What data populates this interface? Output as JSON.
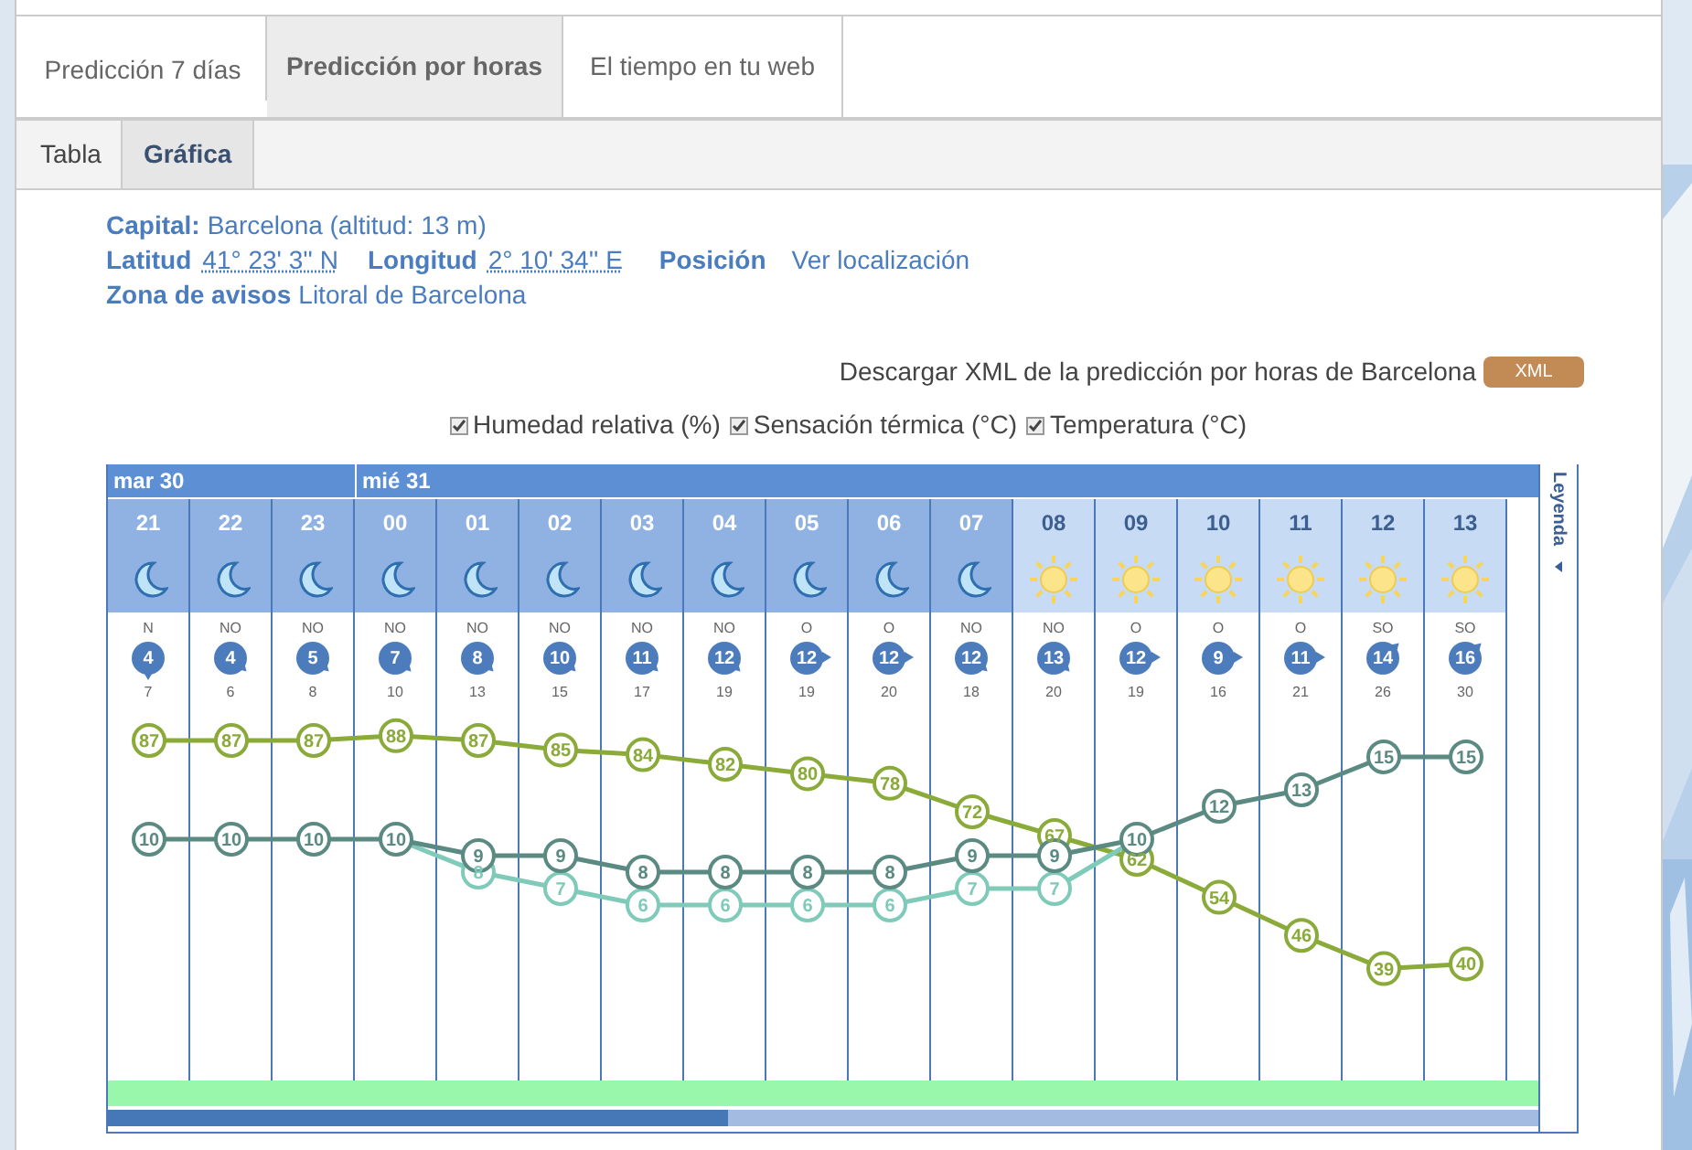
{
  "tabs": [
    {
      "label": "Predicción 7 días",
      "selected": false
    },
    {
      "label": "Predicción por horas",
      "selected": true
    },
    {
      "label": "El tiempo en tu web",
      "selected": false
    }
  ],
  "subtabs": [
    {
      "label": "Tabla",
      "selected": false
    },
    {
      "label": "Gráfica",
      "selected": true
    }
  ],
  "info": {
    "capital_label": "Capital:",
    "capital": "Barcelona (altitud: 13 m)",
    "lat_label": "Latitud",
    "lat": "41° 23' 3'' N",
    "lon_label": "Longitud",
    "lon": "2° 10' 34'' E",
    "pos_label": "Posición",
    "pos_link": "Ver localización",
    "zone_label": "Zona de avisos",
    "zone": "Litoral de Barcelona"
  },
  "download": {
    "text": "Descargar XML de la predicción por horas de Barcelona",
    "button": "XML"
  },
  "filters": [
    {
      "label": "Humedad relativa (%)",
      "checked": true
    },
    {
      "label": "Sensación térmica (°C)",
      "checked": true
    },
    {
      "label": "Temperatura (°C)",
      "checked": true
    }
  ],
  "days": [
    {
      "label": "mar 30",
      "columns": [
        {
          "hour": "21",
          "kind": "night",
          "wind": {
            "direction": "N",
            "speed": "4",
            "kind": "south"
          },
          "gust": "7",
          "humidity": "87",
          "temperature": "10"
        },
        {
          "hour": "22",
          "kind": "night",
          "wind": {
            "direction": "NO",
            "speed": "4",
            "kind": "southeast"
          },
          "gust": "6",
          "humidity": "87",
          "temperature": "10"
        },
        {
          "hour": "23",
          "kind": "night",
          "wind": {
            "direction": "NO",
            "speed": "5",
            "kind": "southeast"
          },
          "gust": "8",
          "humidity": "87",
          "temperature": "10"
        }
      ]
    },
    {
      "label": "mié 31",
      "columns": [
        {
          "hour": "00",
          "kind": "night",
          "wind": {
            "direction": "NO",
            "speed": "7",
            "kind": "southeast"
          },
          "gust": "10",
          "humidity": "88",
          "temperature": "10"
        },
        {
          "hour": "01",
          "kind": "night",
          "wind": {
            "direction": "NO",
            "speed": "8",
            "kind": "southeast"
          },
          "gust": "13",
          "humidity": "87",
          "feels_like": "8",
          "temperature": "9"
        },
        {
          "hour": "02",
          "kind": "night",
          "wind": {
            "direction": "NO",
            "speed": "10",
            "kind": "southeast"
          },
          "gust": "15",
          "humidity": "85",
          "feels_like": "7",
          "temperature": "9"
        },
        {
          "hour": "03",
          "kind": "night",
          "wind": {
            "direction": "NO",
            "speed": "11",
            "kind": "southeast"
          },
          "gust": "17",
          "humidity": "84",
          "feels_like": "6",
          "temperature": "8"
        },
        {
          "hour": "04",
          "kind": "night",
          "wind": {
            "direction": "NO",
            "speed": "12",
            "kind": "southeast"
          },
          "gust": "19",
          "humidity": "82",
          "feels_like": "6",
          "temperature": "8"
        },
        {
          "hour": "05",
          "kind": "night",
          "wind": {
            "direction": "O",
            "speed": "12",
            "kind": "east"
          },
          "gust": "19",
          "humidity": "80",
          "feels_like": "6",
          "temperature": "8"
        },
        {
          "hour": "06",
          "kind": "night",
          "wind": {
            "direction": "O",
            "speed": "12",
            "kind": "east"
          },
          "gust": "20",
          "humidity": "78",
          "feels_like": "6",
          "temperature": "8"
        },
        {
          "hour": "07",
          "kind": "night",
          "wind": {
            "direction": "NO",
            "speed": "12",
            "kind": "southeast"
          },
          "gust": "18",
          "humidity": "72",
          "feels_like": "7",
          "temperature": "9"
        },
        {
          "hour": "08",
          "kind": "day",
          "wind": {
            "direction": "NO",
            "speed": "13",
            "kind": "southeast"
          },
          "gust": "20",
          "humidity": "67",
          "feels_like": "7",
          "temperature": "9"
        },
        {
          "hour": "09",
          "kind": "day",
          "wind": {
            "direction": "O",
            "speed": "12",
            "kind": "east"
          },
          "gust": "19",
          "humidity": "62",
          "temperature": "10"
        },
        {
          "hour": "10",
          "kind": "day",
          "wind": {
            "direction": "O",
            "speed": "9",
            "kind": "east"
          },
          "gust": "16",
          "humidity": "54",
          "temperature": "12"
        },
        {
          "hour": "11",
          "kind": "day",
          "wind": {
            "direction": "O",
            "speed": "11",
            "kind": "east"
          },
          "gust": "21",
          "humidity": "46",
          "temperature": "13"
        },
        {
          "hour": "12",
          "kind": "day",
          "wind": {
            "direction": "SO",
            "speed": "14",
            "kind": "northeast"
          },
          "gust": "26",
          "humidity": "39",
          "temperature": "15"
        },
        {
          "hour": "13",
          "kind": "day",
          "wind": {
            "direction": "SO",
            "speed": "16",
            "kind": "northeast"
          },
          "gust": "30",
          "humidity": "40",
          "temperature": "15"
        }
      ]
    }
  ],
  "legend_tab": "Leyenda"
}
